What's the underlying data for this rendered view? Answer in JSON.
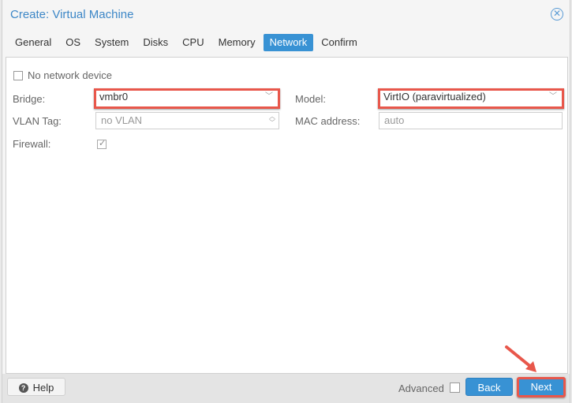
{
  "window": {
    "title": "Create: Virtual Machine",
    "close_icon": "close-circle-icon"
  },
  "tabs": [
    {
      "label": "General",
      "active": false
    },
    {
      "label": "OS",
      "active": false
    },
    {
      "label": "System",
      "active": false
    },
    {
      "label": "Disks",
      "active": false
    },
    {
      "label": "CPU",
      "active": false
    },
    {
      "label": "Memory",
      "active": false
    },
    {
      "label": "Network",
      "active": true
    },
    {
      "label": "Confirm",
      "active": false
    }
  ],
  "form": {
    "no_network_device": {
      "label": "No network device",
      "checked": false
    },
    "bridge": {
      "label": "Bridge:",
      "value": "vmbr0"
    },
    "vlan_tag": {
      "label": "VLAN Tag:",
      "placeholder": "no VLAN"
    },
    "firewall": {
      "label": "Firewall:",
      "checked": true
    },
    "model": {
      "label": "Model:",
      "value": "VirtIO (paravirtualized)"
    },
    "mac_address": {
      "label": "MAC address:",
      "placeholder": "auto"
    }
  },
  "footer": {
    "help_label": "Help",
    "advanced_label": "Advanced",
    "advanced_checked": false,
    "back_label": "Back",
    "next_label": "Next"
  },
  "annotation_color": "#e8574b",
  "accent_color": "#3892d4"
}
